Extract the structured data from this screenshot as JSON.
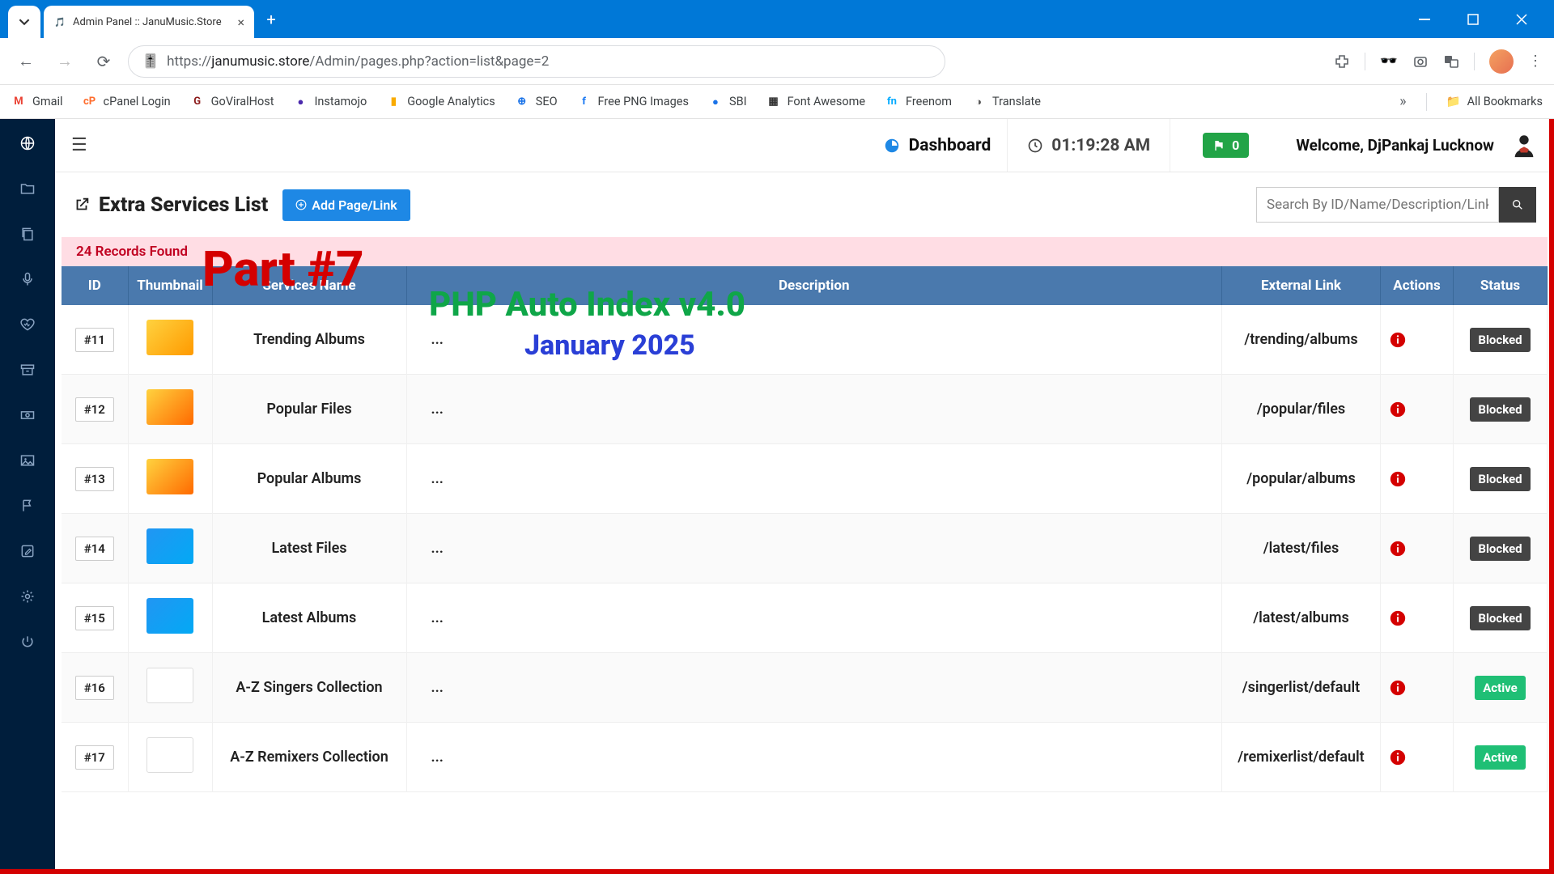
{
  "browser": {
    "tab_title": "Admin Panel :: JanuMusic.Store",
    "url_display_prefix": "https://",
    "url_display_host": "janumusic.store",
    "url_display_path": "/Admin/pages.php?action=list&page=2"
  },
  "bookmarks": [
    {
      "label": "Gmail",
      "icon": "M",
      "color": "#ea4335"
    },
    {
      "label": "cPanel Login",
      "icon": "cP",
      "color": "#ff6c2c"
    },
    {
      "label": "GoViralHost",
      "icon": "G",
      "color": "#8b1a1a"
    },
    {
      "label": "Instamojo",
      "icon": "●",
      "color": "#4b2aad"
    },
    {
      "label": "Google Analytics",
      "icon": "▮",
      "color": "#f9ab00"
    },
    {
      "label": "SEO",
      "icon": "⊕",
      "color": "#1a73e8"
    },
    {
      "label": "Free PNG Images",
      "icon": "f",
      "color": "#1877f2"
    },
    {
      "label": "SBI",
      "icon": "●",
      "color": "#1a73e8"
    },
    {
      "label": "Font Awesome",
      "icon": "▦",
      "color": "#333"
    },
    {
      "label": "Freenom",
      "icon": "fn",
      "color": "#00aaff"
    },
    {
      "label": "Translate",
      "icon": "◑",
      "color": "#555"
    }
  ],
  "all_bookmarks_label": "All Bookmarks",
  "overlay": {
    "part": "Part #7",
    "title": "PHP Auto Index v4.0",
    "subtitle": "January 2025"
  },
  "topbar": {
    "dashboard_label": "Dashboard",
    "time": "01:19:28 AM",
    "flag_count": "0",
    "welcome": "Welcome, DjPankaj Lucknow"
  },
  "page": {
    "title": "Extra Services List",
    "add_button": "Add Page/Link",
    "search_placeholder": "Search By ID/Name/Description/Links",
    "records_found": "24 Records Found"
  },
  "table": {
    "headers": {
      "id": "ID",
      "thumb": "Thumbnail",
      "name": "Services Name",
      "desc": "Description",
      "ext": "External Link",
      "actions": "Actions",
      "status": "Status"
    },
    "rows": [
      {
        "id": "#11",
        "thumb_class": "t1",
        "name": "Trending Albums",
        "desc": "...",
        "ext": "/trending/albums",
        "status": "Blocked",
        "status_class": "blocked"
      },
      {
        "id": "#12",
        "thumb_class": "t2",
        "name": "Popular Files",
        "desc": "...",
        "ext": "/popular/files",
        "status": "Blocked",
        "status_class": "blocked"
      },
      {
        "id": "#13",
        "thumb_class": "t2",
        "name": "Popular Albums",
        "desc": "...",
        "ext": "/popular/albums",
        "status": "Blocked",
        "status_class": "blocked"
      },
      {
        "id": "#14",
        "thumb_class": "t3",
        "name": "Latest Files",
        "desc": "...",
        "ext": "/latest/files",
        "status": "Blocked",
        "status_class": "blocked"
      },
      {
        "id": "#15",
        "thumb_class": "t3",
        "name": "Latest Albums",
        "desc": "...",
        "ext": "/latest/albums",
        "status": "Blocked",
        "status_class": "blocked"
      },
      {
        "id": "#16",
        "thumb_class": "t4",
        "name": "A-Z Singers Collection",
        "desc": "...",
        "ext": "/singerlist/default",
        "status": "Active",
        "status_class": "active"
      },
      {
        "id": "#17",
        "thumb_class": "t4",
        "name": "A-Z Remixers Collection",
        "desc": "...",
        "ext": "/remixerlist/default",
        "status": "Active",
        "status_class": "active"
      }
    ]
  },
  "sidenav_icons": [
    "globe",
    "folder",
    "copy",
    "mic",
    "heart",
    "archive",
    "money",
    "image",
    "flag",
    "pencil",
    "gear",
    "power"
  ]
}
